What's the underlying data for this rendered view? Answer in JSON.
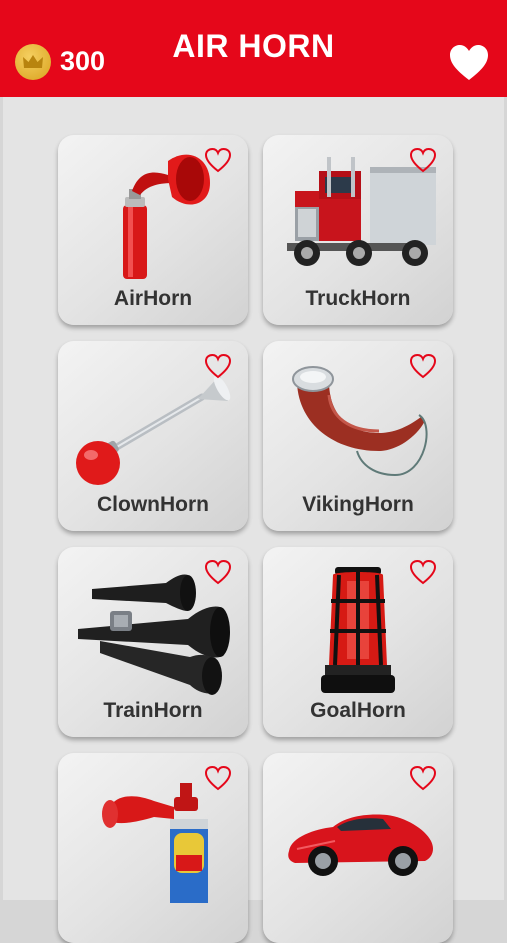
{
  "header": {
    "title": "AIR HORN",
    "coins": "300"
  },
  "colors": {
    "brand_red": "#e5071a",
    "coin_gold": "#e7b83c"
  },
  "tiles": [
    {
      "label": "AirHorn",
      "icon": "air-horn-can"
    },
    {
      "label": "TruckHorn",
      "icon": "semi-truck"
    },
    {
      "label": "ClownHorn",
      "icon": "clown-bulb-horn"
    },
    {
      "label": "VikingHorn",
      "icon": "viking-horn"
    },
    {
      "label": "TrainHorn",
      "icon": "train-horn"
    },
    {
      "label": "GoalHorn",
      "icon": "goal-siren-light"
    },
    {
      "label": "",
      "icon": "gas-horn-can"
    },
    {
      "label": "",
      "icon": "sports-car"
    }
  ]
}
